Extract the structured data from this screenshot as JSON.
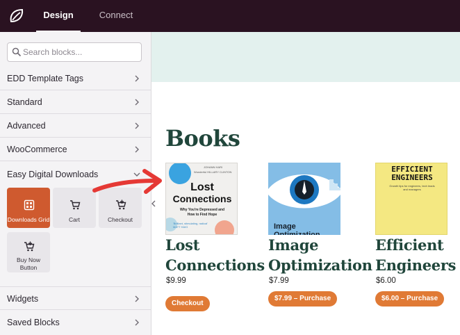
{
  "topbar": {
    "tabs": [
      {
        "label": "Design",
        "active": true
      },
      {
        "label": "Connect",
        "active": false
      }
    ]
  },
  "sidebar": {
    "search_placeholder": "Search blocks...",
    "categories": [
      {
        "label": "EDD Template Tags",
        "expanded": false
      },
      {
        "label": "Standard",
        "expanded": false
      },
      {
        "label": "Advanced",
        "expanded": false
      },
      {
        "label": "WooCommerce",
        "expanded": false
      },
      {
        "label": "Easy Digital Downloads",
        "expanded": true
      },
      {
        "label": "Widgets",
        "expanded": false
      },
      {
        "label": "Saved Blocks",
        "expanded": false
      }
    ],
    "blocks": [
      {
        "label": "Downloads Grid",
        "icon": "grid-icon",
        "active": true
      },
      {
        "label": "Cart",
        "icon": "cart-icon",
        "active": false
      },
      {
        "label": "Checkout",
        "icon": "cart-plus-icon",
        "active": false
      },
      {
        "label": "Buy Now Button",
        "icon": "cart-plus-icon",
        "active": false
      }
    ]
  },
  "canvas": {
    "heading": "Books",
    "books": [
      {
        "title": "Lost Connections",
        "price": "$9.99",
        "button": "Checkout",
        "cover": {
          "author": "JOHANN HARI",
          "blurb": "Wonderful HILLARY CLINTON",
          "title_line1": "Lost",
          "title_line2": "Connections",
          "subtitle": "Why You're Depressed and How to Find Hope",
          "quote": "'Brilliant, stimulating, radical' MATT HAIG"
        }
      },
      {
        "title": "Image Optimization",
        "price": "$7.99",
        "button": "$7.99 – Purchase",
        "cover": {
          "text": "Image Optimization"
        }
      },
      {
        "title": "Efficient Engineers",
        "price": "$6.00",
        "button": "$6.00 – Purchase",
        "cover": {
          "title_line1": "EFFICIENT",
          "title_line2": "ENGINEERS",
          "subtitle": "Growth tips for engineers, tech leads and managers"
        }
      }
    ]
  },
  "colors": {
    "topbar": "#2a1221",
    "accent": "#cf5a2f",
    "button": "#e07a35",
    "heading": "#20463b",
    "hero": "#e3f1ee",
    "arrow": "#e53935"
  }
}
